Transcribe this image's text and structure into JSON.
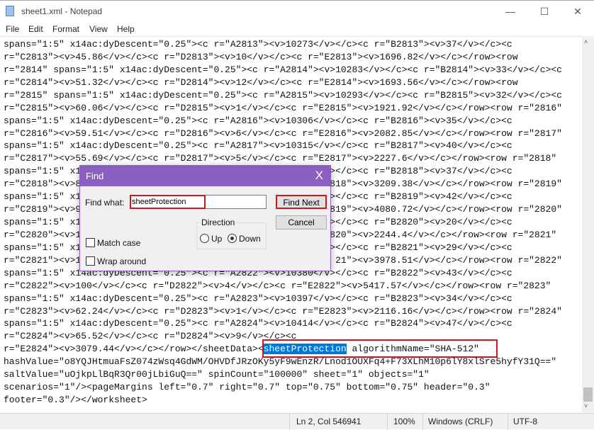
{
  "window": {
    "title": "sheet1.xml - Notepad",
    "minimize": "—",
    "maximize": "☐",
    "close": "✕",
    "icon": "notepad-icon"
  },
  "menu": [
    "File",
    "Edit",
    "Format",
    "View",
    "Help"
  ],
  "editor": {
    "lines": [
      "spans=\"1:5\" x14ac:dyDescent=\"0.25\"><c r=\"A2813\"><v>10273</v></c><c r=\"B2813\"><v>37</v></c><c",
      "r=\"C2813\"><v>45.86</v></c><c r=\"D2813\"><v>10</v></c><c r=\"E2813\"><v>1696.82</v></c></row><row",
      "r=\"2814\" spans=\"1:5\" x14ac:dyDescent=\"0.25\"><c r=\"A2814\"><v>10283</v></c><c r=\"B2814\"><v>33</v></c><c",
      "r=\"C2814\"><v>51.32</v></c><c r=\"D2814\"><v>12</v></c><c r=\"E2814\"><v>1693.56</v></c></row><row",
      "r=\"2815\" spans=\"1:5\" x14ac:dyDescent=\"0.25\"><c r=\"A2815\"><v>10293</v></c><c r=\"B2815\"><v>32</v></c><c",
      "r=\"C2815\"><v>60.06</v></c><c r=\"D2815\"><v>1</v></c><c r=\"E2815\"><v>1921.92</v></c></row><row r=\"2816\"",
      "spans=\"1:5\" x14ac:dyDescent=\"0.25\"><c r=\"A2816\"><v>10306</v></c><c r=\"B2816\"><v>35</v></c><c",
      "r=\"C2816\"><v>59.51</v></c><c r=\"D2816\"><v>6</v></c><c r=\"E2816\"><v>2082.85</v></c></row><row r=\"2817\"",
      "spans=\"1:5\" x14ac:dyDescent=\"0.25\"><c r=\"A2817\"><v>10315</v></c><c r=\"B2817\"><v>40</v></c><c",
      "r=\"C2817\"><v>55.69</v></c><c r=\"D2817\"><v>5</v></c><c r=\"E2817\"><v>2227.6</v></c></row><row r=\"2818\"",
      "spans=\"1:5\" x1                                            v></c><c r=\"B2818\"><v>37</v></c><c",
      "r=\"C2818\"><v>8                                            2818\"><v>3209.38</v></c></row><row r=\"2819\"",
      "spans=\"1:5\" x1                                            v></c><c r=\"B2819\"><v>42</v></c><c",
      "r=\"C2819\"><v>9                                            2819\"><v>4080.72</v></c></row><row r=\"2820\"",
      "spans=\"1:5\" x1                                            v></c><c r=\"B2820\"><v>20</v></c><c",
      "r=\"C2820\"><v>1                                             820\"><v>2244.4</v></c></row><row r=\"2821\"",
      "spans=\"1:5\" x1                                            v></c><c r=\"B2821\"><v>29</v></c><c",
      "r=\"C2821\"><v>1                                              21\"><v>3978.51</v></c></row><row r=\"2822\"",
      "spans=\"1:5\" x14ac:dyDescent=\"0.25\"><c r=\"A2822\"><v>10380</v></c><c r=\"B2822\"><v>43</v></c><c",
      "r=\"C2822\"><v>100</v></c><c r=\"D2822\"><v>4</v></c><c r=\"E2822\"><v>5417.57</v></c></row><row r=\"2823\"",
      "spans=\"1:5\" x14ac:dyDescent=\"0.25\"><c r=\"A2823\"><v>10397</v></c><c r=\"B2823\"><v>34</v></c><c",
      "r=\"C2823\"><v>62.24</v></c><c r=\"D2823\"><v>1</v></c><c r=\"E2823\"><v>2116.16</v></c></row><row r=\"2824\"",
      "spans=\"1:5\" x14ac:dyDescent=\"0.25\"><c r=\"A2824\"><v>10414</v></c><c r=\"B2824\"><v>47</v></c><c",
      "r=\"C2824\"><v>65.52</v></c><c r=\"D2824\"><v>9</v></c><c"
    ],
    "match_line": {
      "before": "r=\"E2824\"><v>3079.44</v></c></row></sheetData><",
      "match": "sheetProtection",
      "after": " algorithmName=\"SHA-512\""
    },
    "tail_lines": [
      "hashValue=\"o8YQJHtmuaFsZ074zWsq4GdWM/OHVDfJRzOKy5yF9wEnzR/Lnod1OUXFq4+F73XLhM10p6lY8xlSre5hyfY31Q==\"",
      "saltValue=\"uOjkpLlBqR3Qr00jLbiGuQ==\" spinCount=\"100000\" sheet=\"1\" objects=\"1\"",
      "scenarios=\"1\"/><pageMargins left=\"0.7\" right=\"0.7\" top=\"0.75\" bottom=\"0.75\" header=\"0.3\"",
      "footer=\"0.3\"/></worksheet>"
    ]
  },
  "find_dialog": {
    "title": "Find",
    "close": "X",
    "find_what_label": "Find what:",
    "find_what_value": "sheetProtection",
    "find_next": "Find Next",
    "cancel": "Cancel",
    "direction_label": "Direction",
    "up": "Up",
    "down": "Down",
    "direction_selected": "Down",
    "match_case": "Match case",
    "match_case_checked": false,
    "wrap_around": "Wrap around",
    "wrap_around_checked": false,
    "accent": "#8b5fbf",
    "highlight_box": "#d0161c"
  },
  "status": {
    "position": "Ln 2, Col 546941",
    "zoom": "100%",
    "line_ending": "Windows (CRLF)",
    "encoding": "UTF-8"
  },
  "scrollbar": {
    "up": "˄",
    "down": "˅"
  }
}
